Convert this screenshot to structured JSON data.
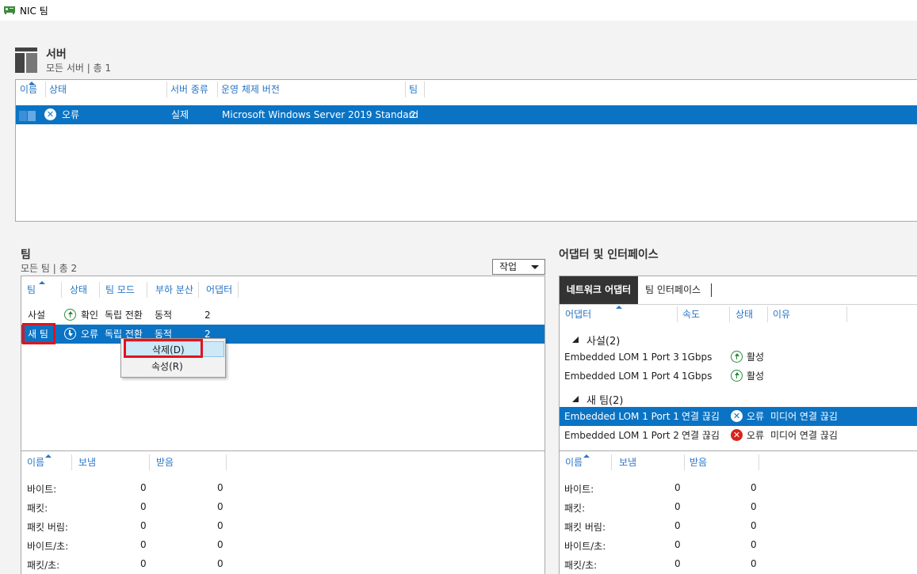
{
  "window": {
    "title": "NIC 팀"
  },
  "server": {
    "title": "서버",
    "subtitle": "모든 서버 | 총 1",
    "columns": [
      "이름",
      "상태",
      "서버 종류",
      "운영 체제 버전",
      "팀"
    ],
    "rows": [
      {
        "status": "오류",
        "type": "실제",
        "os": "Microsoft Windows Server 2019 Standard",
        "teams": "2"
      }
    ]
  },
  "teams": {
    "title": "팀",
    "subtitle": "모든 팀 | 총 2",
    "tasks_label": "작업",
    "columns": [
      "팀",
      "상태",
      "팀 모드",
      "부하 분산",
      "어댑터"
    ],
    "rows": [
      {
        "name": "사설",
        "status": "확인",
        "mode": "독립 전환",
        "lb": "동적",
        "adapters": "2"
      },
      {
        "name": "새 팀",
        "status": "오류",
        "mode": "독립 전환",
        "lb": "동적",
        "adapters": "2"
      }
    ],
    "context_menu": {
      "delete": "삭제(D)",
      "properties": "속성(R)"
    },
    "stats": {
      "columns": [
        "이름",
        "보냄",
        "받음"
      ],
      "rows": [
        {
          "label": "바이트:",
          "sent": "0",
          "recv": "0"
        },
        {
          "label": "패킷:",
          "sent": "0",
          "recv": "0"
        },
        {
          "label": "패킷 버림:",
          "sent": "0",
          "recv": "0"
        },
        {
          "label": "바이트/초:",
          "sent": "0",
          "recv": "0"
        },
        {
          "label": "패킷/초:",
          "sent": "0",
          "recv": "0"
        }
      ]
    }
  },
  "adapters": {
    "title": "어댑터 및 인터페이스",
    "tabs": [
      "네트워크 어댑터",
      "팀 인터페이스"
    ],
    "columns": [
      "어댑터",
      "속도",
      "상태",
      "이유"
    ],
    "groups": [
      {
        "name": "사설(2)",
        "rows": [
          {
            "adapter": "Embedded LOM 1 Port 3",
            "speed": "1Gbps",
            "status": "활성",
            "reason": ""
          },
          {
            "adapter": "Embedded LOM 1 Port 4",
            "speed": "1Gbps",
            "status": "활성",
            "reason": ""
          }
        ]
      },
      {
        "name": "새 팀(2)",
        "rows": [
          {
            "adapter": "Embedded LOM 1 Port 1",
            "speed": "연결 끊김",
            "status": "오류",
            "reason": "미디어 연결 끊김"
          },
          {
            "adapter": "Embedded LOM 1 Port 2",
            "speed": "연결 끊김",
            "status": "오류",
            "reason": "미디어 연결 끊김"
          }
        ]
      }
    ],
    "stats": {
      "columns": [
        "이름",
        "보냄",
        "받음"
      ],
      "rows": [
        {
          "label": "바이트:",
          "sent": "0",
          "recv": "0"
        },
        {
          "label": "패킷:",
          "sent": "0",
          "recv": "0"
        },
        {
          "label": "패킷 버림:",
          "sent": "0",
          "recv": "0"
        },
        {
          "label": "바이트/초:",
          "sent": "0",
          "recv": "0"
        },
        {
          "label": "패킷/초:",
          "sent": "0",
          "recv": "0"
        }
      ]
    }
  }
}
